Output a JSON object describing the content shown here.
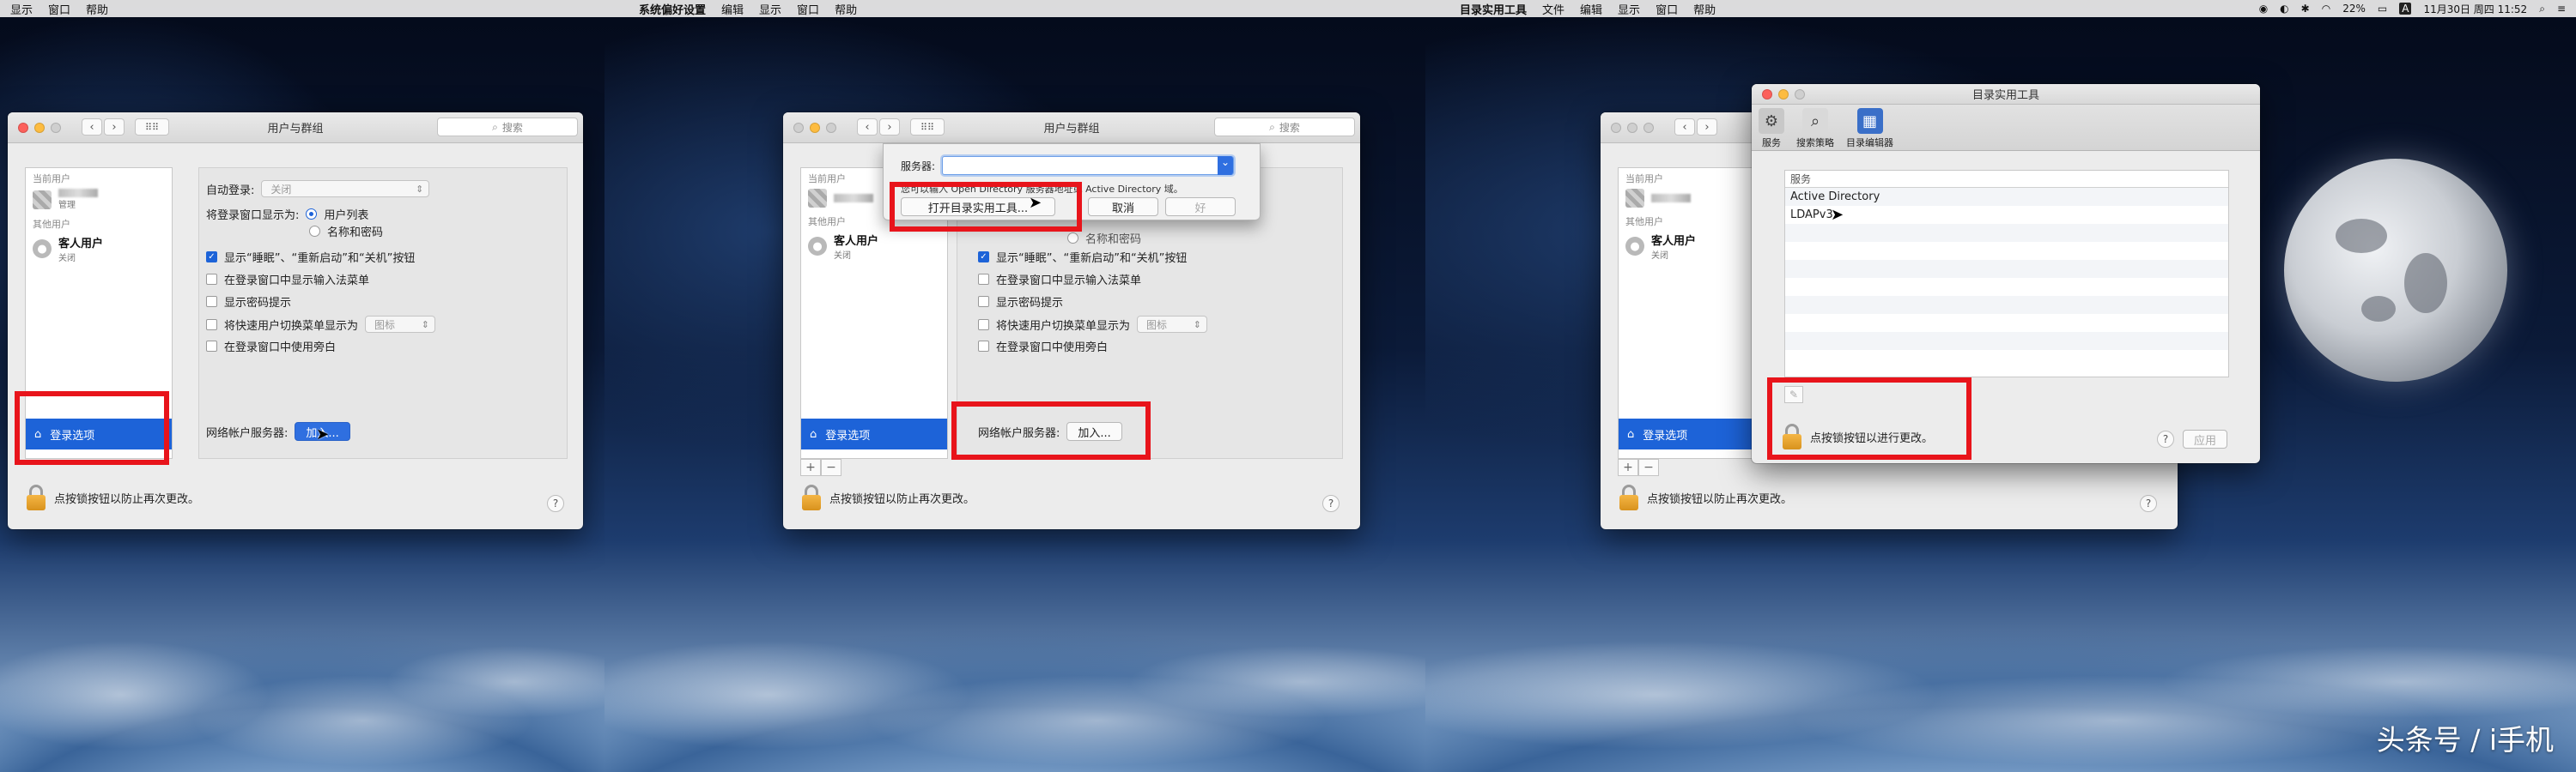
{
  "panel1": {
    "menubar": {
      "items": [
        "显示",
        "窗口",
        "帮助"
      ]
    },
    "window": {
      "title": "用户与群组",
      "search_placeholder": "搜索",
      "sidebar": {
        "current_users_header": "当前用户",
        "current_user_sub": "管理",
        "other_users_header": "其他用户",
        "guest_name": "客人用户",
        "guest_status": "关闭",
        "login_options": "登录选项"
      },
      "settings": {
        "auto_login_label": "自动登录:",
        "auto_login_value": "关闭",
        "display_as_label": "将登录窗口显示为:",
        "display_option_1": "用户列表",
        "display_option_2": "名称和密码",
        "check_1": "显示“睡眠”、“重新启动”和“关机”按钮",
        "check_2": "在登录窗口中显示输入法菜单",
        "check_3": "显示密码提示",
        "check_4": "将快速用户切换菜单显示为",
        "check_4_value": "图标",
        "check_5": "在登录窗口中使用旁白",
        "network_label": "网络帐户服务器:",
        "join_button": "加入..."
      },
      "lock_text": "点按锁按钮以防止再次更改。",
      "help": "?"
    }
  },
  "panel2": {
    "menubar": {
      "items": [
        "系统偏好设置",
        "编辑",
        "显示",
        "窗口",
        "帮助"
      ]
    },
    "window": {
      "title": "用户与群组",
      "search_placeholder": "搜索",
      "sheet": {
        "server_label": "服务器:",
        "hint": "您可以输入 Open Directory 服务器地址或 Active Directory 域。",
        "open_utility_button": "打开目录实用工具...",
        "cancel_button": "取消",
        "ok_button": "好"
      },
      "sidebar": {
        "current_users_header": "当前用户",
        "other_users_header": "其他用户",
        "guest_name": "客人用户",
        "guest_status": "关闭",
        "login_options": "登录选项"
      },
      "settings": {
        "check_1": "显示“睡眠”、“重新启动”和“关机”按钮",
        "check_2": "在登录窗口中显示输入法菜单",
        "check_3": "显示密码提示",
        "check_4": "将快速用户切换菜单显示为",
        "check_4_value": "图标",
        "check_5": "在登录窗口中使用旁白",
        "partial_option": "名称和密码",
        "network_label": "网络帐户服务器:",
        "join_button": "加入..."
      },
      "lock_text": "点按锁按钮以防止再次更改。",
      "help": "?"
    }
  },
  "panel3": {
    "menubar": {
      "items": [
        "目录实用工具",
        "文件",
        "编辑",
        "显示",
        "窗口",
        "帮助"
      ],
      "battery": "22%",
      "input_indicator": "A",
      "datetime": "11月30日 周四 11:52"
    },
    "back_window": {
      "sidebar": {
        "current_users_header": "当前用户",
        "other_users_header": "其他用户",
        "guest_name": "客人用户",
        "guest_status": "关闭",
        "login_options": "登录选项"
      },
      "lock_text": "点按锁按钮以防止再次更改。",
      "help": "?"
    },
    "directory_window": {
      "title": "目录实用工具",
      "toolbar": [
        "服务",
        "搜索策略",
        "目录编辑器"
      ],
      "list_header": "服务",
      "services": [
        "Active Directory",
        "LDAPv3"
      ],
      "lock_text": "点按锁按钮以进行更改。",
      "apply_button": "应用",
      "help": "?"
    }
  },
  "watermark": "头条号 / i手机"
}
